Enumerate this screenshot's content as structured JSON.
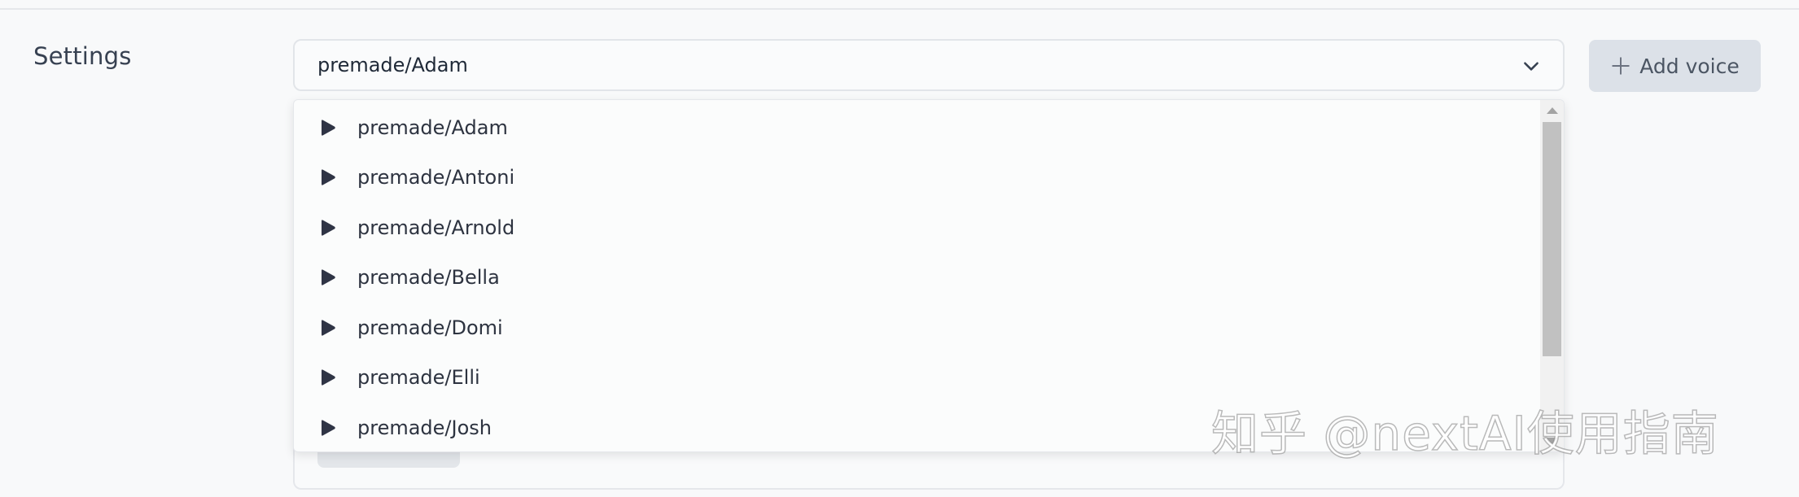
{
  "settings": {
    "label": "Settings"
  },
  "voice_select": {
    "value": "premade/Adam",
    "icon": "chevron-down-icon"
  },
  "add_voice": {
    "label": "Add voice",
    "icon": "plus-icon"
  },
  "dropdown": {
    "options": [
      {
        "label": "premade/Adam",
        "icon": "play-icon"
      },
      {
        "label": "premade/Antoni",
        "icon": "play-icon"
      },
      {
        "label": "premade/Arnold",
        "icon": "play-icon"
      },
      {
        "label": "premade/Bella",
        "icon": "play-icon"
      },
      {
        "label": "premade/Domi",
        "icon": "play-icon"
      },
      {
        "label": "premade/Elli",
        "icon": "play-icon"
      },
      {
        "label": "premade/Josh",
        "icon": "play-icon"
      }
    ]
  },
  "watermark": {
    "text": "知乎 @nextAI使用指南"
  },
  "colors": {
    "background": "#f8f9fa",
    "button_bg": "#dce1e8",
    "play_icon": "#2f3445",
    "scroll_thumb": "#c1c1c1"
  }
}
